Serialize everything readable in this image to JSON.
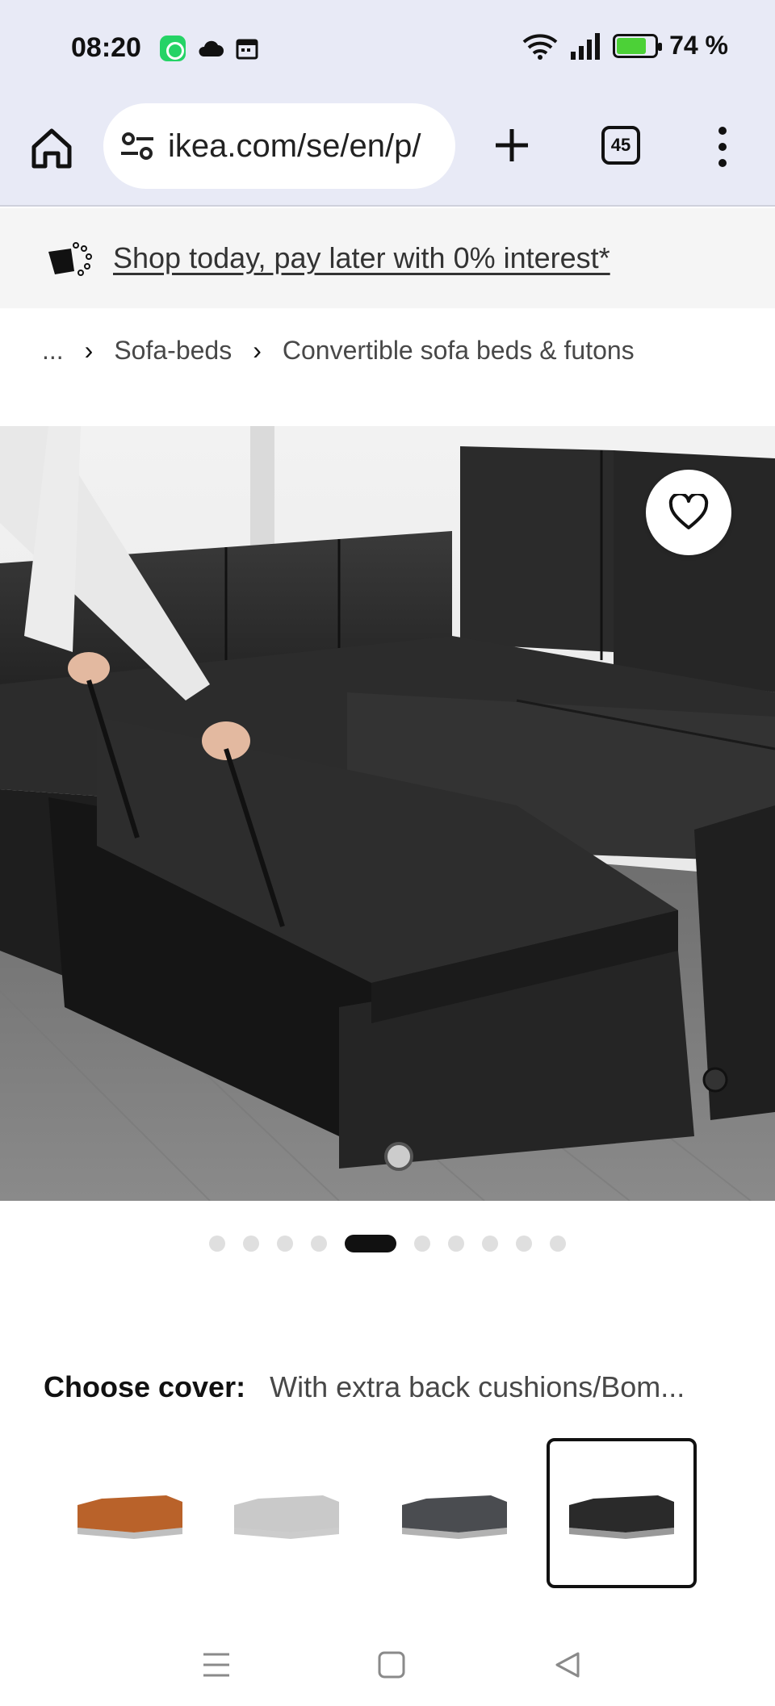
{
  "status_bar": {
    "time": "08:20",
    "battery": "74 %"
  },
  "browser": {
    "url": "ikea.com/se/en/p/",
    "tab_count": "45"
  },
  "promo": {
    "text": "Shop today, pay later with 0% interest*"
  },
  "breadcrumb": {
    "ellipsis": "...",
    "items": [
      "Sofa-beds",
      "Convertible sofa beds & futons"
    ]
  },
  "gallery": {
    "slide_count": 10,
    "active_slide": 5
  },
  "cover": {
    "label": "Choose cover:",
    "value": "With extra back cushions/Bom...",
    "options": [
      {
        "color": "#b9622a",
        "selected": false
      },
      {
        "color": "#c9c9c9",
        "selected": false
      },
      {
        "color": "#4a4c50",
        "selected": false
      },
      {
        "color": "#2a2a2a",
        "selected": true
      }
    ]
  },
  "colors": {
    "status_bg": "#e8eaf6",
    "promo_bg": "#f5f5f5"
  }
}
